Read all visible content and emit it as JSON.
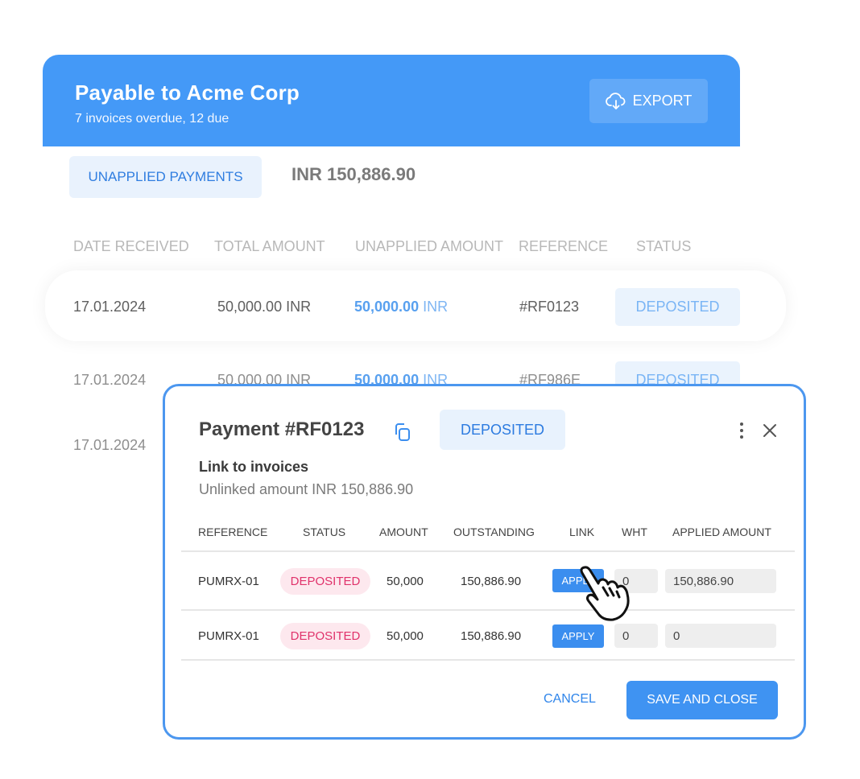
{
  "header": {
    "title": "Payable to Acme Corp",
    "subtitle": "7 invoices overdue, 12 due",
    "export_label": "EXPORT",
    "export_icon": "cloud-download-icon"
  },
  "summary": {
    "tab_label": "UNAPPLIED PAYMENTS",
    "total": "INR 150,886.90"
  },
  "payments_table": {
    "columns": [
      "DATE RECEIVED",
      "TOTAL AMOUNT",
      "UNAPPLIED AMOUNT",
      "REFERENCE",
      "STATUS"
    ],
    "rows": [
      {
        "date": "17.01.2024",
        "total": "50,000.00 INR",
        "unapplied_value": "50,000.00",
        "unapplied_unit": "INR",
        "reference": "#RF0123",
        "status": "DEPOSITED"
      },
      {
        "date": "17.01.2024",
        "total": "50,000.00 INR",
        "unapplied_value": "50,000.00",
        "unapplied_unit": "INR",
        "reference": "#RF986E",
        "status": "DEPOSITED"
      },
      {
        "date": "17.01.2024"
      }
    ]
  },
  "modal": {
    "title": "Payment #RF0123",
    "status": "DEPOSITED",
    "section_title": "Link to invoices",
    "unlinked": "Unlinked amount INR 150,886.90",
    "columns": [
      "REFERENCE",
      "STATUS",
      "AMOUNT",
      "OUTSTANDING",
      "LINK",
      "WHT",
      "APPLIED AMOUNT"
    ],
    "rows": [
      {
        "reference": "PUMRX-01",
        "status": "DEPOSITED",
        "amount": "50,000",
        "outstanding": "150,886.90",
        "link": "APPLY",
        "wht": "0",
        "applied": "150,886.90"
      },
      {
        "reference": "PUMRX-01",
        "status": "DEPOSITED",
        "amount": "50,000",
        "outstanding": "150,886.90",
        "link": "APPLY",
        "wht": "0",
        "applied": "0"
      }
    ],
    "cancel_label": "CANCEL",
    "save_label": "SAVE AND CLOSE"
  },
  "colors": {
    "primary": "#4499f7",
    "status_pink": "#e0326b",
    "status_pink_bg": "#fde8ee",
    "badge_blue_bg": "#e8f2fd"
  }
}
